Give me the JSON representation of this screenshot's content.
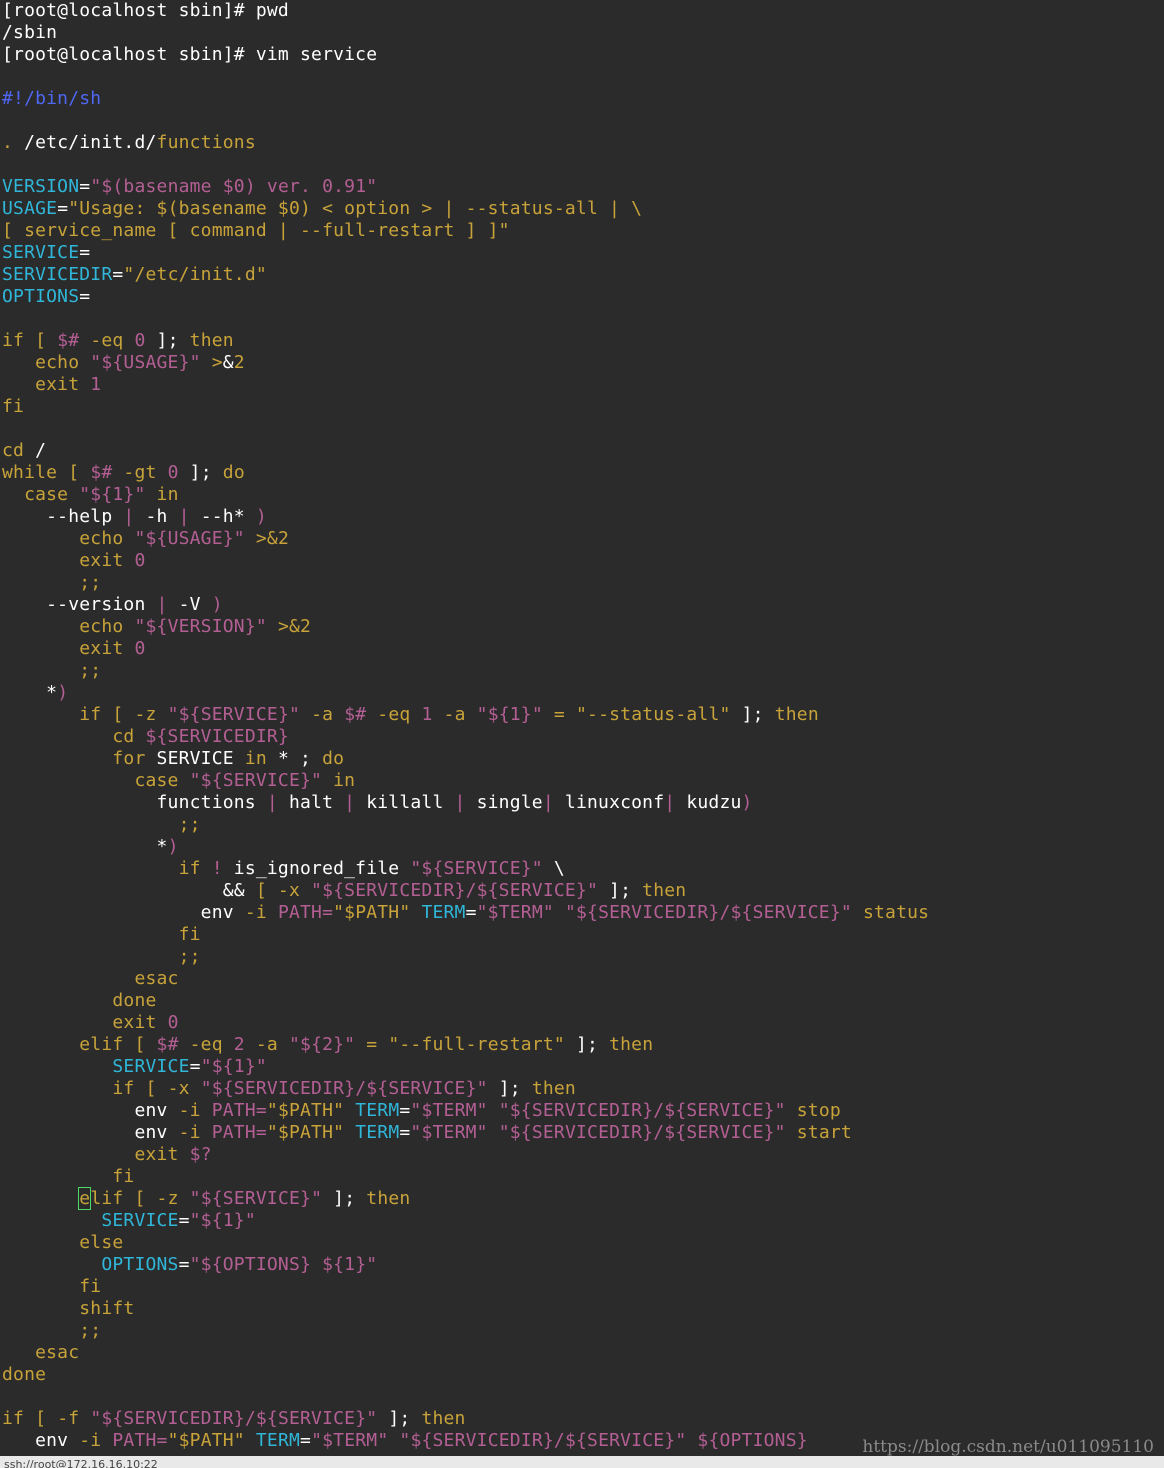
{
  "terminal": {
    "lines": [
      [
        {
          "t": "[root@localhost sbin]# pwd",
          "c": "w"
        }
      ],
      [
        {
          "t": "/sbin",
          "c": "w"
        }
      ],
      [
        {
          "t": "[root@localhost sbin]# vim service",
          "c": "w"
        }
      ],
      [],
      [
        {
          "t": "#!/bin/sh",
          "c": "sh"
        }
      ],
      [],
      [
        {
          "t": ". ",
          "c": "k"
        },
        {
          "t": "/etc/init.d/",
          "c": "w"
        },
        {
          "t": "functions",
          "c": "k"
        }
      ],
      [],
      [
        {
          "t": "VERSION",
          "c": "v"
        },
        {
          "t": "=",
          "c": "w"
        },
        {
          "t": "\"$(basename $0) ver. 0.91\"",
          "c": "s"
        }
      ],
      [
        {
          "t": "USAGE",
          "c": "v"
        },
        {
          "t": "=",
          "c": "w"
        },
        {
          "t": "\"Usage: $(basename $0) < option > | --status-all | \\",
          "c": "k"
        }
      ],
      [
        {
          "t": "[ service_name [ command | --full-restart ] ]\"",
          "c": "k"
        }
      ],
      [
        {
          "t": "SERVICE",
          "c": "v"
        },
        {
          "t": "=",
          "c": "w"
        }
      ],
      [
        {
          "t": "SERVICEDIR",
          "c": "v"
        },
        {
          "t": "=",
          "c": "w"
        },
        {
          "t": "\"/etc/init.d\"",
          "c": "k"
        }
      ],
      [
        {
          "t": "OPTIONS",
          "c": "v"
        },
        {
          "t": "=",
          "c": "w"
        }
      ],
      [],
      [
        {
          "t": "if",
          "c": "k"
        },
        {
          "t": " [ ",
          "c": "k"
        },
        {
          "t": "$#",
          "c": "s"
        },
        {
          "t": " -eq ",
          "c": "k"
        },
        {
          "t": "0",
          "c": "s"
        },
        {
          "t": " ]; ",
          "c": "w"
        },
        {
          "t": "then",
          "c": "k"
        }
      ],
      [
        {
          "t": "   echo ",
          "c": "k"
        },
        {
          "t": "\"${USAGE}\"",
          "c": "s"
        },
        {
          "t": " >",
          "c": "k"
        },
        {
          "t": "&",
          "c": "w"
        },
        {
          "t": "2",
          "c": "k"
        }
      ],
      [
        {
          "t": "   exit ",
          "c": "k"
        },
        {
          "t": "1",
          "c": "s"
        }
      ],
      [
        {
          "t": "fi",
          "c": "k"
        }
      ],
      [],
      [
        {
          "t": "cd",
          "c": "k"
        },
        {
          "t": " /",
          "c": "w"
        }
      ],
      [
        {
          "t": "while",
          "c": "k"
        },
        {
          "t": " [ ",
          "c": "k"
        },
        {
          "t": "$#",
          "c": "s"
        },
        {
          "t": " -gt ",
          "c": "k"
        },
        {
          "t": "0",
          "c": "s"
        },
        {
          "t": " ]; ",
          "c": "w"
        },
        {
          "t": "do",
          "c": "k"
        }
      ],
      [
        {
          "t": "  case ",
          "c": "k"
        },
        {
          "t": "\"${1}\"",
          "c": "s"
        },
        {
          "t": " in",
          "c": "k"
        }
      ],
      [
        {
          "t": "    --help ",
          "c": "w"
        },
        {
          "t": "| ",
          "c": "s"
        },
        {
          "t": "-h ",
          "c": "w"
        },
        {
          "t": "| ",
          "c": "s"
        },
        {
          "t": "--h* ",
          "c": "w"
        },
        {
          "t": ")",
          "c": "s"
        }
      ],
      [
        {
          "t": "       echo ",
          "c": "k"
        },
        {
          "t": "\"${USAGE}\"",
          "c": "s"
        },
        {
          "t": " >&2",
          "c": "k"
        }
      ],
      [
        {
          "t": "       exit ",
          "c": "k"
        },
        {
          "t": "0",
          "c": "s"
        }
      ],
      [
        {
          "t": "       ;;",
          "c": "k"
        }
      ],
      [
        {
          "t": "    --version ",
          "c": "w"
        },
        {
          "t": "| ",
          "c": "s"
        },
        {
          "t": "-V ",
          "c": "w"
        },
        {
          "t": ")",
          "c": "s"
        }
      ],
      [
        {
          "t": "       echo ",
          "c": "k"
        },
        {
          "t": "\"${VERSION}\"",
          "c": "s"
        },
        {
          "t": " >&2",
          "c": "k"
        }
      ],
      [
        {
          "t": "       exit ",
          "c": "k"
        },
        {
          "t": "0",
          "c": "s"
        }
      ],
      [
        {
          "t": "       ;;",
          "c": "k"
        }
      ],
      [
        {
          "t": "    *",
          "c": "w"
        },
        {
          "t": ")",
          "c": "s"
        }
      ],
      [
        {
          "t": "       if",
          "c": "k"
        },
        {
          "t": " [ -z ",
          "c": "k"
        },
        {
          "t": "\"${SERVICE}\"",
          "c": "s"
        },
        {
          "t": " -a ",
          "c": "k"
        },
        {
          "t": "$#",
          "c": "s"
        },
        {
          "t": " -eq ",
          "c": "k"
        },
        {
          "t": "1",
          "c": "s"
        },
        {
          "t": " -a ",
          "c": "k"
        },
        {
          "t": "\"${1}\"",
          "c": "s"
        },
        {
          "t": " = ",
          "c": "k"
        },
        {
          "t": "\"--status-all\"",
          "c": "k"
        },
        {
          "t": " ]; ",
          "c": "w"
        },
        {
          "t": "then",
          "c": "k"
        }
      ],
      [
        {
          "t": "          cd ",
          "c": "k"
        },
        {
          "t": "${SERVICEDIR}",
          "c": "s"
        }
      ],
      [
        {
          "t": "          for ",
          "c": "k"
        },
        {
          "t": "SERVICE ",
          "c": "w"
        },
        {
          "t": "in ",
          "c": "k"
        },
        {
          "t": "* ; ",
          "c": "w"
        },
        {
          "t": "do",
          "c": "k"
        }
      ],
      [
        {
          "t": "            case ",
          "c": "k"
        },
        {
          "t": "\"${SERVICE}\"",
          "c": "s"
        },
        {
          "t": " in",
          "c": "k"
        }
      ],
      [
        {
          "t": "              functions ",
          "c": "w"
        },
        {
          "t": "| ",
          "c": "s"
        },
        {
          "t": "halt ",
          "c": "w"
        },
        {
          "t": "| ",
          "c": "s"
        },
        {
          "t": "killall ",
          "c": "w"
        },
        {
          "t": "| ",
          "c": "s"
        },
        {
          "t": "single",
          "c": "w"
        },
        {
          "t": "| ",
          "c": "s"
        },
        {
          "t": "linuxconf",
          "c": "w"
        },
        {
          "t": "| ",
          "c": "s"
        },
        {
          "t": "kudzu",
          "c": "w"
        },
        {
          "t": ")",
          "c": "s"
        }
      ],
      [
        {
          "t": "                ;;",
          "c": "k"
        }
      ],
      [
        {
          "t": "              *",
          "c": "w"
        },
        {
          "t": ")",
          "c": "s"
        }
      ],
      [
        {
          "t": "                if ",
          "c": "k"
        },
        {
          "t": "! ",
          "c": "s"
        },
        {
          "t": "is_ignored_file ",
          "c": "w"
        },
        {
          "t": "\"${SERVICE}\"",
          "c": "s"
        },
        {
          "t": " \\",
          "c": "w"
        }
      ],
      [
        {
          "t": "                    && ",
          "c": "w"
        },
        {
          "t": "[ -x ",
          "c": "k"
        },
        {
          "t": "\"${SERVICEDIR}/${SERVICE}\"",
          "c": "s"
        },
        {
          "t": " ]; ",
          "c": "w"
        },
        {
          "t": "then",
          "c": "k"
        }
      ],
      [
        {
          "t": "                  env ",
          "c": "w"
        },
        {
          "t": "-i ",
          "c": "k"
        },
        {
          "t": "PATH=",
          "c": "s"
        },
        {
          "t": "\"$PATH\"",
          "c": "k"
        },
        {
          "t": " ",
          "c": "w"
        },
        {
          "t": "TERM",
          "c": "v"
        },
        {
          "t": "=",
          "c": "w"
        },
        {
          "t": "\"$TERM\"",
          "c": "s"
        },
        {
          "t": " ",
          "c": "w"
        },
        {
          "t": "\"${SERVICEDIR}/${SERVICE}\"",
          "c": "s"
        },
        {
          "t": " status",
          "c": "k"
        }
      ],
      [
        {
          "t": "                fi",
          "c": "k"
        }
      ],
      [
        {
          "t": "                ;;",
          "c": "k"
        }
      ],
      [
        {
          "t": "            esac",
          "c": "k"
        }
      ],
      [
        {
          "t": "          done",
          "c": "k"
        }
      ],
      [
        {
          "t": "          exit ",
          "c": "k"
        },
        {
          "t": "0",
          "c": "s"
        }
      ],
      [
        {
          "t": "       elif",
          "c": "k"
        },
        {
          "t": " [ ",
          "c": "k"
        },
        {
          "t": "$#",
          "c": "s"
        },
        {
          "t": " -eq ",
          "c": "k"
        },
        {
          "t": "2",
          "c": "s"
        },
        {
          "t": " -a ",
          "c": "k"
        },
        {
          "t": "\"${2}\"",
          "c": "s"
        },
        {
          "t": " = ",
          "c": "k"
        },
        {
          "t": "\"--full-restart\"",
          "c": "k"
        },
        {
          "t": " ]; ",
          "c": "w"
        },
        {
          "t": "then",
          "c": "k"
        }
      ],
      [
        {
          "t": "          SERVICE",
          "c": "v"
        },
        {
          "t": "=",
          "c": "w"
        },
        {
          "t": "\"${1}\"",
          "c": "s"
        }
      ],
      [
        {
          "t": "          if",
          "c": "k"
        },
        {
          "t": " [ -x ",
          "c": "k"
        },
        {
          "t": "\"${SERVICEDIR}/${SERVICE}\"",
          "c": "s"
        },
        {
          "t": " ]; ",
          "c": "w"
        },
        {
          "t": "then",
          "c": "k"
        }
      ],
      [
        {
          "t": "            env ",
          "c": "w"
        },
        {
          "t": "-i ",
          "c": "k"
        },
        {
          "t": "PATH=",
          "c": "s"
        },
        {
          "t": "\"$PATH\"",
          "c": "k"
        },
        {
          "t": " ",
          "c": "w"
        },
        {
          "t": "TERM",
          "c": "v"
        },
        {
          "t": "=",
          "c": "w"
        },
        {
          "t": "\"$TERM\"",
          "c": "s"
        },
        {
          "t": " ",
          "c": "w"
        },
        {
          "t": "\"${SERVICEDIR}/${SERVICE}\"",
          "c": "s"
        },
        {
          "t": " stop",
          "c": "k"
        }
      ],
      [
        {
          "t": "            env ",
          "c": "w"
        },
        {
          "t": "-i ",
          "c": "k"
        },
        {
          "t": "PATH=",
          "c": "s"
        },
        {
          "t": "\"$PATH\"",
          "c": "k"
        },
        {
          "t": " ",
          "c": "w"
        },
        {
          "t": "TERM",
          "c": "v"
        },
        {
          "t": "=",
          "c": "w"
        },
        {
          "t": "\"$TERM\"",
          "c": "s"
        },
        {
          "t": " ",
          "c": "w"
        },
        {
          "t": "\"${SERVICEDIR}/${SERVICE}\"",
          "c": "s"
        },
        {
          "t": " start",
          "c": "k"
        }
      ],
      [
        {
          "t": "            exit ",
          "c": "k"
        },
        {
          "t": "$?",
          "c": "s"
        }
      ],
      [
        {
          "t": "          fi",
          "c": "k"
        }
      ],
      [
        {
          "t": "       ",
          "c": "w"
        },
        {
          "t": "e",
          "c": "k",
          "cursor": true
        },
        {
          "t": "lif",
          "c": "k"
        },
        {
          "t": " [ -z ",
          "c": "k"
        },
        {
          "t": "\"${SERVICE}\"",
          "c": "s"
        },
        {
          "t": " ]; ",
          "c": "w"
        },
        {
          "t": "then",
          "c": "k"
        }
      ],
      [
        {
          "t": "         SERVICE",
          "c": "v"
        },
        {
          "t": "=",
          "c": "w"
        },
        {
          "t": "\"${1}\"",
          "c": "s"
        }
      ],
      [
        {
          "t": "       else",
          "c": "k"
        }
      ],
      [
        {
          "t": "         OPTIONS",
          "c": "v"
        },
        {
          "t": "=",
          "c": "w"
        },
        {
          "t": "\"${OPTIONS} ${1}\"",
          "c": "s"
        }
      ],
      [
        {
          "t": "       fi",
          "c": "k"
        }
      ],
      [
        {
          "t": "       shift",
          "c": "k"
        }
      ],
      [
        {
          "t": "       ;;",
          "c": "k"
        }
      ],
      [
        {
          "t": "   esac",
          "c": "k"
        }
      ],
      [
        {
          "t": "done",
          "c": "k"
        }
      ],
      [],
      [
        {
          "t": "if",
          "c": "k"
        },
        {
          "t": " [ -f ",
          "c": "k"
        },
        {
          "t": "\"${SERVICEDIR}/${SERVICE}\"",
          "c": "s"
        },
        {
          "t": " ]; ",
          "c": "w"
        },
        {
          "t": "then",
          "c": "k"
        }
      ],
      [
        {
          "t": "   env ",
          "c": "w"
        },
        {
          "t": "-i ",
          "c": "k"
        },
        {
          "t": "PATH=",
          "c": "s"
        },
        {
          "t": "\"$PATH\"",
          "c": "k"
        },
        {
          "t": " ",
          "c": "w"
        },
        {
          "t": "TERM",
          "c": "v"
        },
        {
          "t": "=",
          "c": "w"
        },
        {
          "t": "\"$TERM\"",
          "c": "s"
        },
        {
          "t": " ",
          "c": "w"
        },
        {
          "t": "\"${SERVICEDIR}/${SERVICE}\"",
          "c": "s"
        },
        {
          "t": " ${OPTIONS}",
          "c": "s"
        }
      ]
    ]
  },
  "watermark": "https://blog.csdn.net/u011095110",
  "statusbar": {
    "text": "ssh://root@172.16.16.10:22"
  },
  "colors": {
    "background": "#2b2b2b",
    "text": "#ffffff",
    "keyword": "#c8a33a",
    "string": "#b45f94",
    "variable": "#30b6d8",
    "shebang": "#4f67f4",
    "cursor": "#4cd964"
  }
}
